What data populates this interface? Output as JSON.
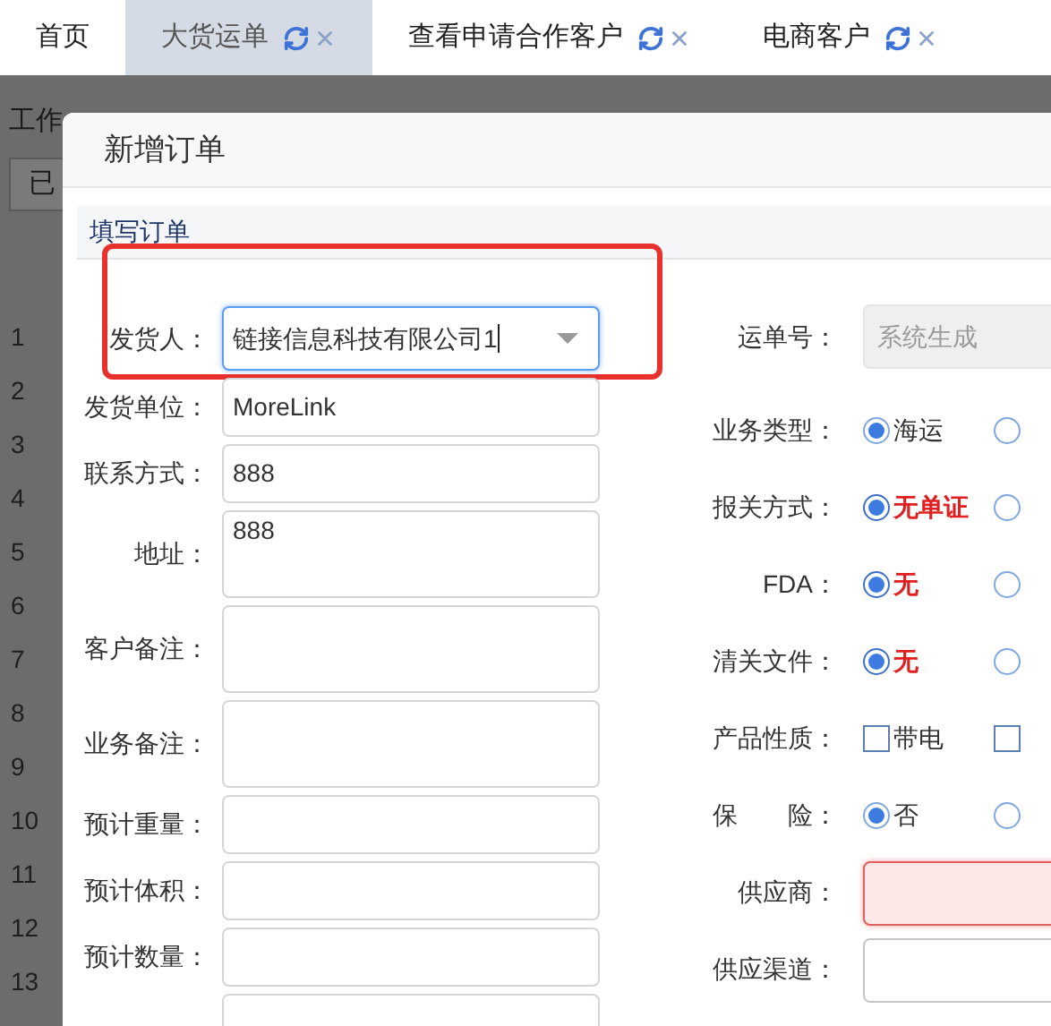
{
  "tabs": [
    {
      "label": "首页",
      "selected": false,
      "closable": false
    },
    {
      "label": "大货运单",
      "selected": true,
      "closable": true
    },
    {
      "label": "查看申请合作客户",
      "selected": false,
      "closable": true
    },
    {
      "label": "电商客户",
      "selected": false,
      "closable": true
    }
  ],
  "background": {
    "filter_label": "工作",
    "filter_button": "已",
    "row_numbers": [
      "1",
      "2",
      "3",
      "4",
      "5",
      "6",
      "7",
      "8",
      "9",
      "10",
      "11",
      "12",
      "13"
    ]
  },
  "dialog": {
    "title": "新增订单",
    "section": "填写订单",
    "left_fields": [
      {
        "label": "发货人：",
        "kind": "select",
        "value": "链接信息科技有限公司1",
        "focused": true,
        "annotated": true
      },
      {
        "label": "发货单位：",
        "kind": "input",
        "value": "MoreLink",
        "focused": false,
        "annotated": false
      },
      {
        "label": "联系方式：",
        "kind": "input",
        "value": "888",
        "focused": false,
        "annotated": false
      },
      {
        "label": "地址：",
        "kind": "textarea",
        "value": "888",
        "focused": false,
        "annotated": false
      },
      {
        "label": "客户备注：",
        "kind": "textarea",
        "focused": false,
        "annotated": false
      },
      {
        "label": "业务备注：",
        "kind": "textarea",
        "focused": false,
        "annotated": false
      },
      {
        "label": "预计重量：",
        "kind": "input",
        "focused": false,
        "annotated": false
      },
      {
        "label": "预计体积：",
        "kind": "input",
        "focused": false,
        "annotated": false
      },
      {
        "label": "预计数量：",
        "kind": "input",
        "focused": false,
        "annotated": false
      },
      {
        "kind": "input",
        "focused": false,
        "annotated": false
      }
    ],
    "right_fields": [
      {
        "label": "运单号：",
        "kind": "input",
        "placeholder": "系统生成",
        "disabled": true,
        "invalid": false
      },
      {
        "label": "业务类型：",
        "kind": "radio",
        "options": [
          {
            "label": "海运",
            "selected": true,
            "alert": false
          },
          {
            "selected": false,
            "alert": false
          }
        ]
      },
      {
        "label": "报关方式：",
        "kind": "radio",
        "options": [
          {
            "label": "无单证",
            "selected": true,
            "alert": true
          },
          {
            "selected": false,
            "alert": false
          }
        ]
      },
      {
        "label": "FDA：",
        "kind": "radio",
        "options": [
          {
            "label": "无",
            "selected": true,
            "alert": true
          },
          {
            "selected": false,
            "alert": false
          }
        ]
      },
      {
        "label": "清关文件：",
        "kind": "radio",
        "options": [
          {
            "label": "无",
            "selected": true,
            "alert": true
          },
          {
            "selected": false,
            "alert": false
          }
        ]
      },
      {
        "label": "产品性质：",
        "kind": "checkbox",
        "options": [
          {
            "label": "带电",
            "checked": false
          },
          {
            "checked": false
          }
        ]
      },
      {
        "label": "保　　险：",
        "kind": "radio",
        "options": [
          {
            "label": "否",
            "selected": true,
            "alert": false
          },
          {
            "selected": false,
            "alert": false
          }
        ]
      },
      {
        "label": "供应商：",
        "kind": "input",
        "disabled": false,
        "invalid": true
      },
      {
        "label": "供应渠道：",
        "kind": "input",
        "disabled": false,
        "invalid": false
      }
    ]
  }
}
